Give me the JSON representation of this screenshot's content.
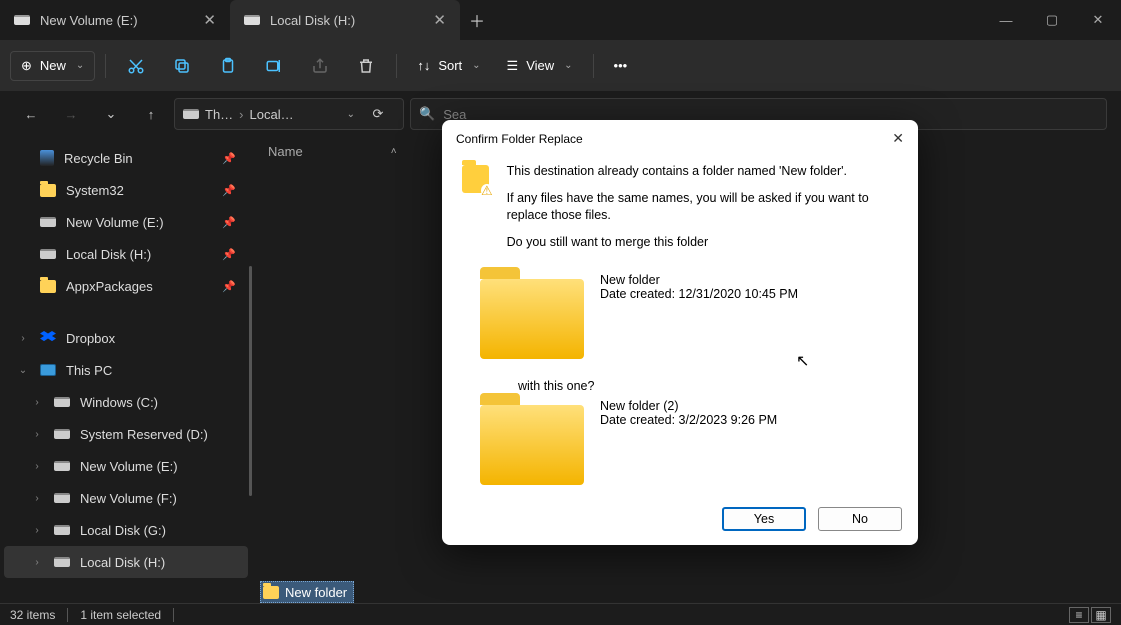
{
  "tabs": [
    {
      "label": "New Volume (E:)",
      "active": false
    },
    {
      "label": "Local Disk (H:)",
      "active": true
    }
  ],
  "toolbar": {
    "new_label": "New",
    "sort_label": "Sort",
    "view_label": "View"
  },
  "breadcrumb": {
    "part1": "Th…",
    "part2": "Local…"
  },
  "search": {
    "placeholder": "Sea"
  },
  "quick": [
    {
      "name": "Recycle Bin",
      "icon": "recycle"
    },
    {
      "name": "System32",
      "icon": "folder"
    },
    {
      "name": "New Volume (E:)",
      "icon": "drive"
    },
    {
      "name": "Local Disk (H:)",
      "icon": "drive"
    },
    {
      "name": "AppxPackages",
      "icon": "folder"
    }
  ],
  "tree": {
    "dropbox": "Dropbox",
    "thispc": "This PC",
    "drives": [
      "Windows (C:)",
      "System Reserved (D:)",
      "New Volume (E:)",
      "New Volume (F:)",
      "Local Disk (G:)",
      "Local Disk (H:)"
    ]
  },
  "columns": {
    "name": "Name"
  },
  "selected_item": "New folder",
  "status": {
    "items": "32 items",
    "selected": "1 item selected"
  },
  "dialog": {
    "title": "Confirm Folder Replace",
    "line1": "This destination already contains a folder named 'New folder'.",
    "line2": "If any files have the same names, you will be asked if you want to replace those files.",
    "line3": "Do you still want to merge this folder",
    "dest_name": "New folder",
    "dest_date": "Date created: 12/31/2020 10:45 PM",
    "line4": "with this one?",
    "src_name": "New folder (2)",
    "src_date": "Date created: 3/2/2023 9:26 PM",
    "yes": "Yes",
    "no": "No"
  }
}
